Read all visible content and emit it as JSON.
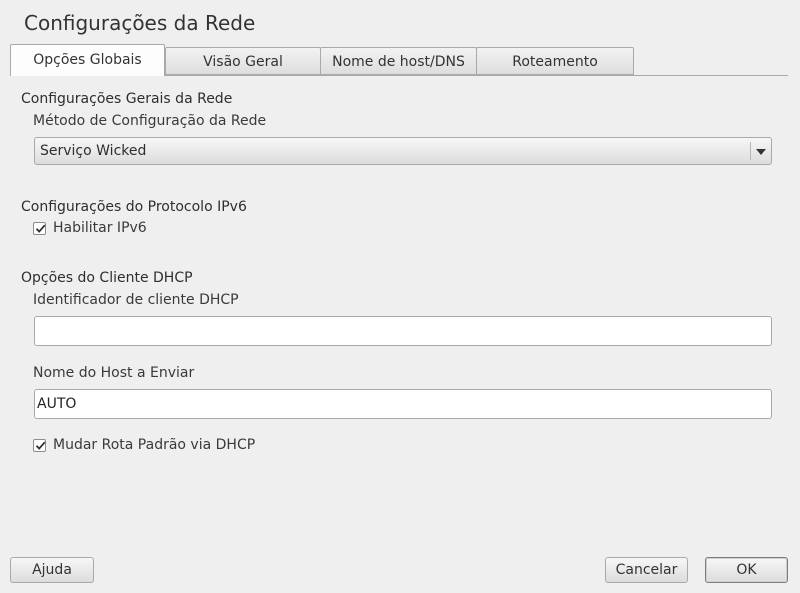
{
  "window": {
    "title": "Configurações da Rede"
  },
  "tabs": [
    {
      "label": "Opções Globais",
      "active": true
    },
    {
      "label": "Visão Geral",
      "active": false
    },
    {
      "label": "Nome de host/DNS",
      "active": false
    },
    {
      "label": "Roteamento",
      "active": false
    }
  ],
  "general": {
    "section_title": "Configurações Gerais da Rede",
    "method_label": "Método de Configuração da Rede",
    "method_value": "Serviço Wicked"
  },
  "ipv6": {
    "section_title": "Configurações do Protocolo IPv6",
    "enable_label": "Habilitar IPv6",
    "enabled": true
  },
  "dhcp": {
    "section_title": "Opções do Cliente DHCP",
    "client_id_label": "Identificador de cliente DHCP",
    "client_id_value": "",
    "hostname_label": "Nome do Host a Enviar",
    "hostname_value": "AUTO",
    "default_route_label": "Mudar Rota Padrão via DHCP",
    "default_route_checked": true
  },
  "buttons": {
    "help": "Ajuda",
    "cancel": "Cancelar",
    "ok": "OK"
  },
  "icons": {
    "combo_arrow": "chevron-down-icon",
    "check": "checkmark-icon"
  }
}
